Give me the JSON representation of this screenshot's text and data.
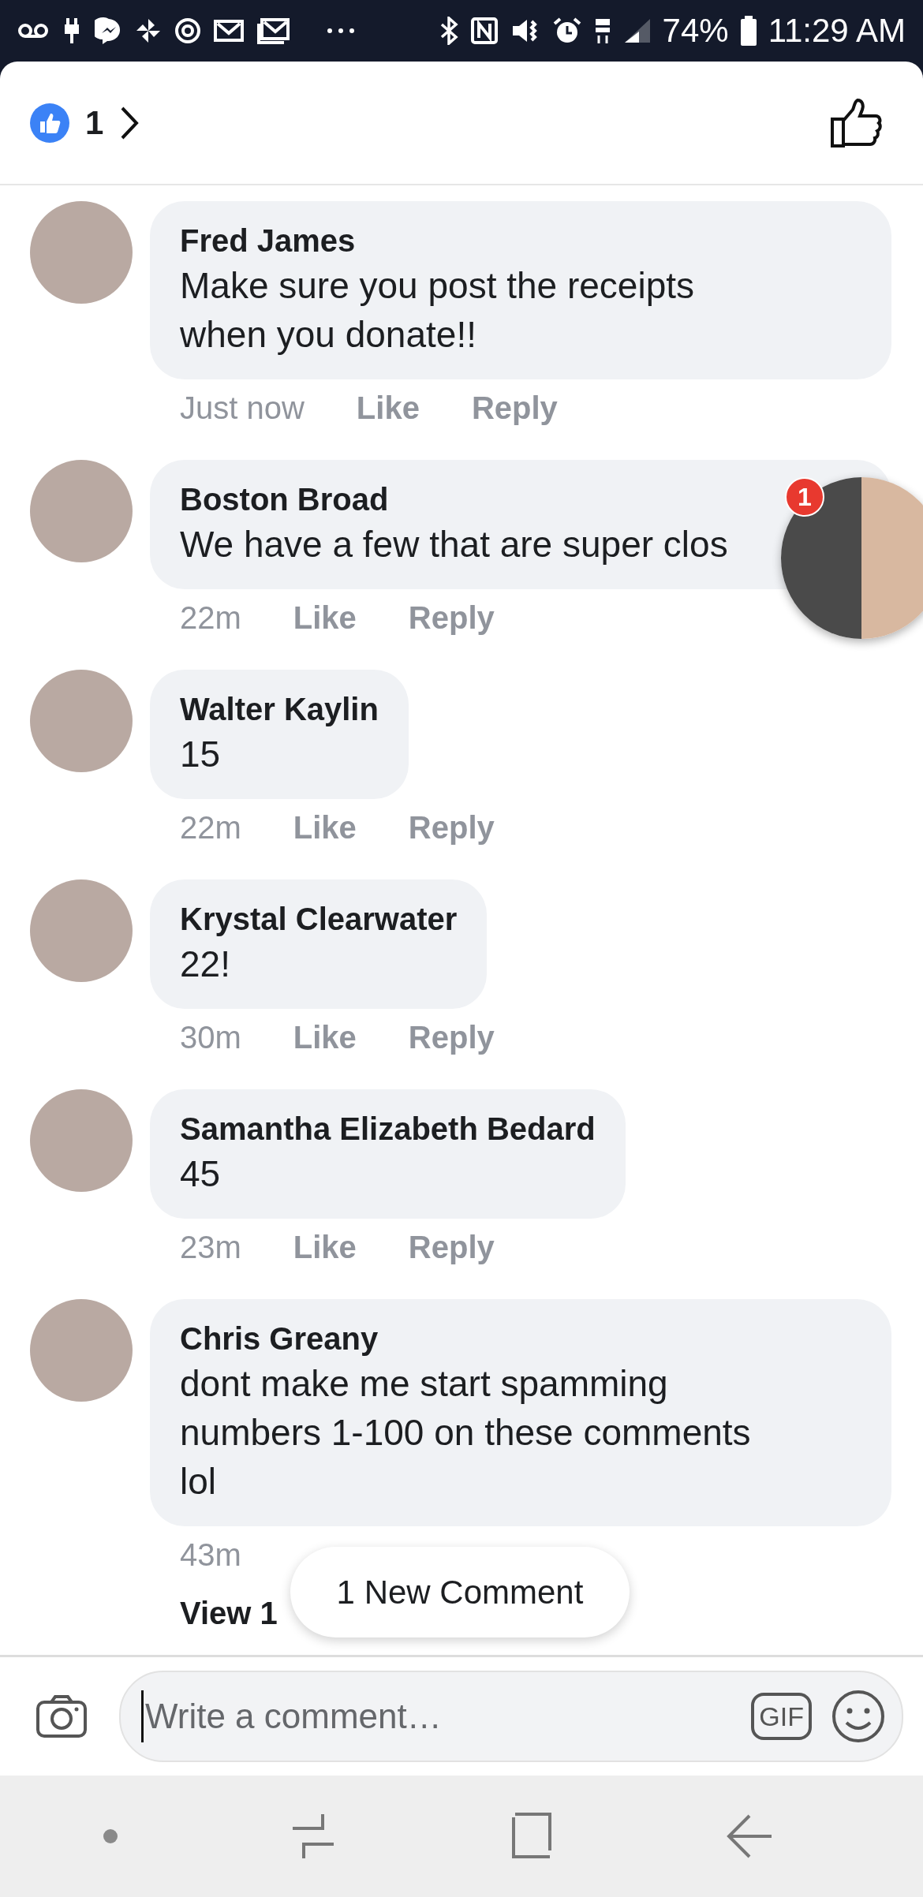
{
  "status_bar": {
    "battery": "74%",
    "time": "11:29 AM"
  },
  "header": {
    "reaction_count": "1"
  },
  "comments": [
    {
      "author": "Fred James",
      "text": "Make sure you post the receipts\nwhen you donate!!",
      "time": "Just now",
      "actions": [
        "Like",
        "Reply"
      ],
      "wide": true
    },
    {
      "author": "Boston Broad",
      "text": "We have a few that are super clos",
      "time": "22m",
      "actions": [
        "Like",
        "Reply"
      ],
      "wide": true
    },
    {
      "author": "Walter Kaylin",
      "text": "15",
      "time": "22m",
      "actions": [
        "Like",
        "Reply"
      ],
      "wide": false
    },
    {
      "author": "Krystal Clearwater",
      "text": "22!",
      "time": "30m",
      "actions": [
        "Like",
        "Reply"
      ],
      "wide": false
    },
    {
      "author": "Samantha Elizabeth Bedard",
      "text": "45",
      "time": "23m",
      "actions": [
        "Like",
        "Reply"
      ],
      "wide": false
    },
    {
      "author": "Chris Greany",
      "text": "dont make me start spamming\nnumbers 1-100 on these comments\nlol",
      "time": "43m",
      "wide": true,
      "replies_link": "View 1"
    }
  ],
  "new_comment_toast": "1 New Comment",
  "chat_head": {
    "badge": "1"
  },
  "composer": {
    "placeholder": "Write a comment…",
    "gif": "GIF"
  }
}
